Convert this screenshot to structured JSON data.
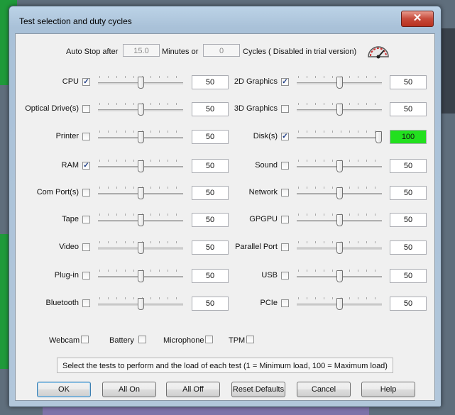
{
  "window": {
    "title": "Test selection and duty cycles",
    "close_glyph": "✕"
  },
  "autostop": {
    "prefix": "Auto Stop after",
    "minutes_value": "15.0",
    "minutes_label": "Minutes or",
    "cycles_value": "0",
    "cycles_label": "Cycles ( Disabled in trial version)"
  },
  "left_tests": [
    {
      "label": "CPU",
      "checked": true,
      "load": "50",
      "level": 0.5
    },
    {
      "label": "Optical Drive(s)",
      "checked": false,
      "load": "50",
      "level": 0.5
    },
    {
      "label": "Printer",
      "checked": false,
      "load": "50",
      "level": 0.5
    },
    {
      "label": "RAM",
      "checked": true,
      "load": "50",
      "level": 0.5
    },
    {
      "label": "Com Port(s)",
      "checked": false,
      "load": "50",
      "level": 0.5
    },
    {
      "label": "Tape",
      "checked": false,
      "load": "50",
      "level": 0.5
    },
    {
      "label": "Video",
      "checked": false,
      "load": "50",
      "level": 0.5
    },
    {
      "label": "Plug-in",
      "checked": false,
      "load": "50",
      "level": 0.5
    },
    {
      "label": "Bluetooth",
      "checked": false,
      "load": "50",
      "level": 0.5
    }
  ],
  "right_tests": [
    {
      "label": "2D Graphics",
      "checked": true,
      "load": "50",
      "level": 0.5
    },
    {
      "label": "3D Graphics",
      "checked": false,
      "load": "50",
      "level": 0.5
    },
    {
      "label": "Disk(s)",
      "checked": true,
      "load": "100",
      "level": 1.0,
      "highlight": "#22e01e"
    },
    {
      "label": "Sound",
      "checked": false,
      "load": "50",
      "level": 0.5
    },
    {
      "label": "Network",
      "checked": false,
      "load": "50",
      "level": 0.5
    },
    {
      "label": "GPGPU",
      "checked": false,
      "load": "50",
      "level": 0.5
    },
    {
      "label": "Parallel Port",
      "checked": false,
      "load": "50",
      "level": 0.5
    },
    {
      "label": "USB",
      "checked": false,
      "load": "50",
      "level": 0.5
    },
    {
      "label": "PCIe",
      "checked": false,
      "load": "50",
      "level": 0.5
    }
  ],
  "extras": [
    {
      "label": "Webcam",
      "checked": false
    },
    {
      "label": "Battery",
      "checked": false
    },
    {
      "label": "Microphone",
      "checked": false
    },
    {
      "label": "TPM",
      "checked": false
    }
  ],
  "status": "Select the tests to perform and the load of each test (1 = Minimum load, 100 = Maximum load)",
  "buttons": {
    "ok": "OK",
    "all_on": "All On",
    "all_off": "All Off",
    "reset": "Reset Defaults",
    "cancel": "Cancel",
    "help": "Help"
  },
  "icons": {
    "gauge": "speedometer-icon",
    "check": "✓"
  }
}
